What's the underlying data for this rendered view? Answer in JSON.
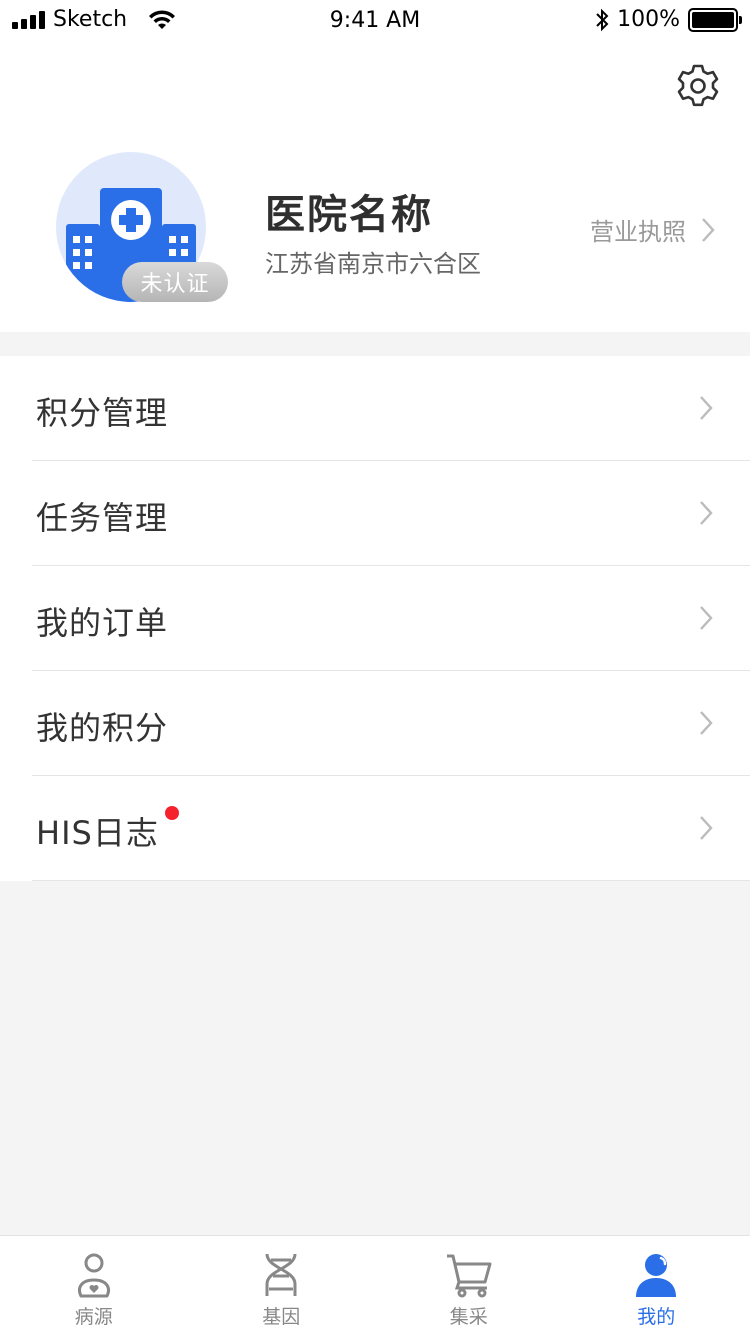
{
  "status_bar": {
    "carrier": "Sketch",
    "time": "9:41 AM",
    "battery": "100%"
  },
  "profile": {
    "hospital_name": "医院名称",
    "address": "江苏省南京市六合区",
    "badge": "未认证",
    "license_label": "营业执照"
  },
  "menu": [
    {
      "label": "积分管理"
    },
    {
      "label": "任务管理"
    },
    {
      "label": "我的订单"
    },
    {
      "label": "我的积分"
    },
    {
      "label": "HIS日志",
      "has_dot": true
    }
  ],
  "tabs": [
    {
      "label": "病源",
      "icon": "patient-icon"
    },
    {
      "label": "基因",
      "icon": "dna-icon"
    },
    {
      "label": "集采",
      "icon": "cart-icon"
    },
    {
      "label": "我的",
      "icon": "user-icon",
      "active": true
    }
  ],
  "colors": {
    "accent": "#2a6fe8",
    "dot": "#f5222d",
    "background": "#f4f4f4"
  }
}
